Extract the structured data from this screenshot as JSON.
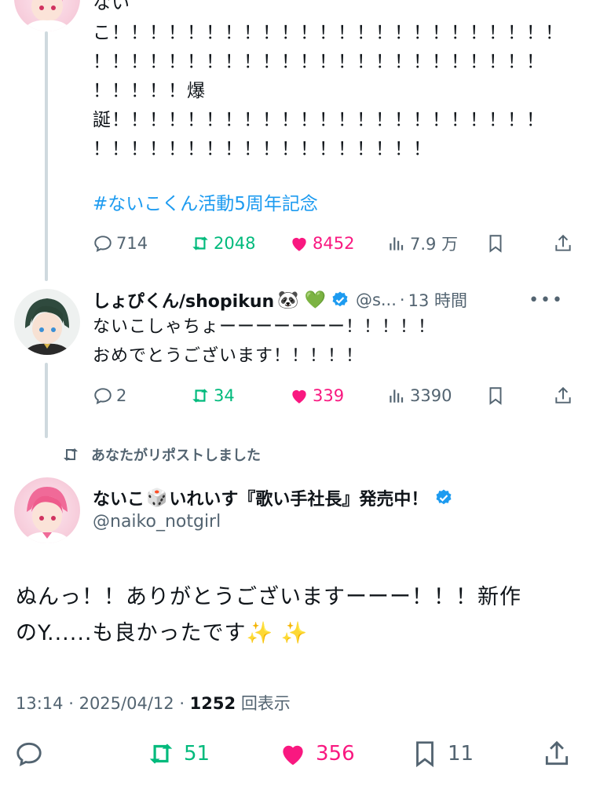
{
  "tweet1": {
    "lines": [
      "ない",
      "こ！！！！！！！！！！！！！！！！！！！！！！！！",
      "！！！！！！！！！！！！！！！！！！！！！！！！",
      "！！！！！爆",
      "誕！！！！！！！！！！！！！！！！！！！！！！！",
      "！！！！！！！！！！！！！！！！！！"
    ],
    "hashtag": "#ないこくん活動5周年記念",
    "stats": {
      "replies": "714",
      "reposts": "2048",
      "likes": "8452",
      "views": "7.9 万"
    }
  },
  "tweet2": {
    "name": "しょぴくん/shopikun",
    "emoji": "🐼 💚",
    "handle": "@s...",
    "time": "13 時間",
    "more": "•••",
    "lines": [
      "ないこしゃちょーーーーーーー！！！！！",
      "おめでとうございます！！！！！"
    ],
    "stats": {
      "replies": "2",
      "reposts": "34",
      "likes": "339",
      "views": "3390"
    }
  },
  "repost_label": "あなたがリポストしました",
  "main": {
    "name_part1": "ないこ",
    "emoji": "🎲",
    "name_part2": "いれいす『歌い手社長』発売中！",
    "handle": "@naiko_notgirl",
    "lines": [
      "ぬんっ！！ありがとうございますーーー！！！新作",
      "のY......も良かったです✨ ✨"
    ],
    "time": "13:14",
    "date": "2025/04/12",
    "views_count": "1252",
    "views_label": "回表示",
    "stats": {
      "reposts": "51",
      "likes": "356",
      "bookmarks": "11"
    }
  },
  "colors": {
    "blue": "#1d9bf0",
    "green": "#00ba7c",
    "pink": "#f91880",
    "gray": "#536471"
  }
}
